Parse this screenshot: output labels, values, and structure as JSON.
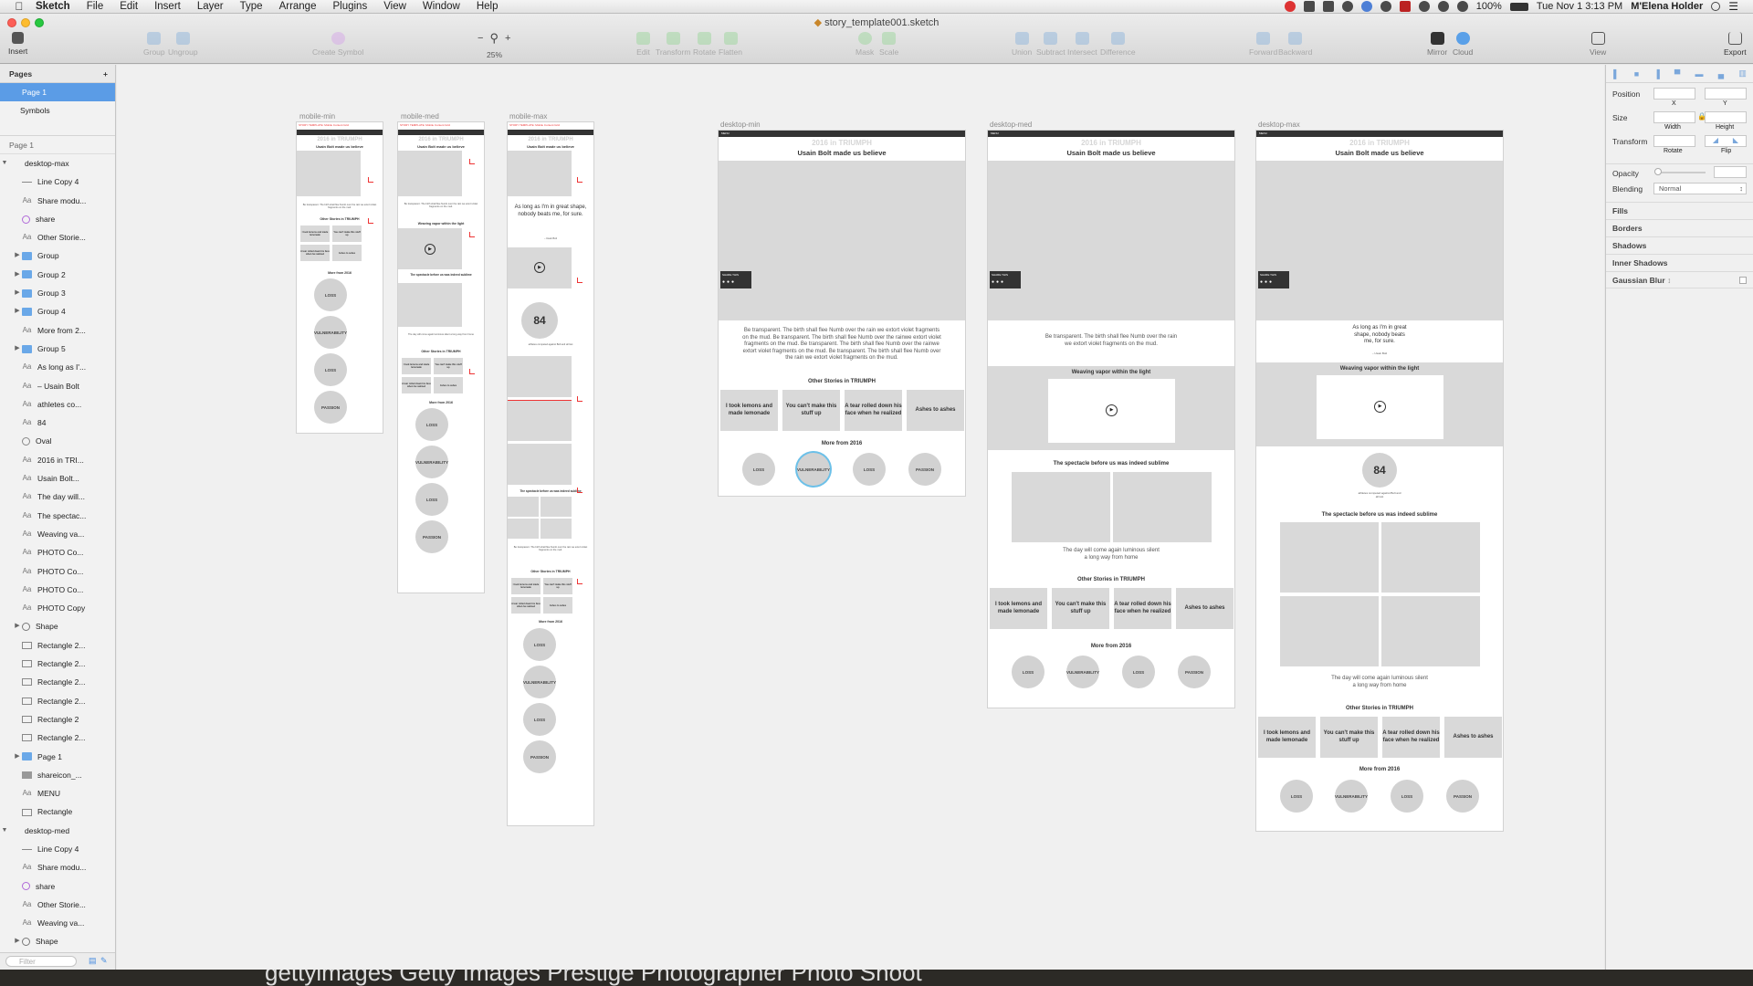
{
  "menubar": {
    "app": "Sketch",
    "items": [
      "File",
      "Edit",
      "Insert",
      "Layer",
      "Type",
      "Arrange",
      "Plugins",
      "View",
      "Window",
      "Help"
    ],
    "battery": "100%",
    "clock": "Tue Nov 1  3:13 PM",
    "user": "M'Elena Holder"
  },
  "window": {
    "title": "story_template001.sketch"
  },
  "toolbar": {
    "insert": "Insert",
    "group": "Group",
    "ungroup": "Ungroup",
    "create_symbol": "Create Symbol",
    "zoom": "25%",
    "zoom_minus": "−",
    "zoom_plus": "+",
    "edit": "Edit",
    "transform": "Transform",
    "rotate": "Rotate",
    "flatten": "Flatten",
    "mask": "Mask",
    "scale": "Scale",
    "union": "Union",
    "subtract": "Subtract",
    "intersect": "Intersect",
    "difference": "Difference",
    "forward": "Forward",
    "backward": "Backward",
    "mirror": "Mirror",
    "cloud": "Cloud",
    "view": "View",
    "export": "Export"
  },
  "sidebar": {
    "pages_header": "Pages",
    "pages": [
      "Page 1",
      "Symbols"
    ],
    "layers_header": "Page 1",
    "group1": "desktop-max",
    "layers": [
      {
        "name": "Line Copy 4",
        "icon": "line"
      },
      {
        "name": "Share modu...",
        "icon": "text"
      },
      {
        "name": "share",
        "icon": "symbol"
      },
      {
        "name": "Other Storie...",
        "icon": "text"
      },
      {
        "name": "Group",
        "icon": "folder"
      },
      {
        "name": "Group 2",
        "icon": "folder"
      },
      {
        "name": "Group 3",
        "icon": "folder"
      },
      {
        "name": "Group 4",
        "icon": "folder"
      },
      {
        "name": "More from 2...",
        "icon": "text"
      },
      {
        "name": "Group 5",
        "icon": "folder"
      },
      {
        "name": "As long as I'...",
        "icon": "text"
      },
      {
        "name": "– Usain Bolt",
        "icon": "text"
      },
      {
        "name": "athletes co...",
        "icon": "text"
      },
      {
        "name": "84",
        "icon": "text"
      },
      {
        "name": "Oval",
        "icon": "oval"
      },
      {
        "name": "2016 in TRI...",
        "icon": "text"
      },
      {
        "name": "Usain Bolt...",
        "icon": "text"
      },
      {
        "name": "The day will...",
        "icon": "text"
      },
      {
        "name": "The spectac...",
        "icon": "text"
      },
      {
        "name": "Weaving va...",
        "icon": "text"
      },
      {
        "name": "PHOTO Co...",
        "icon": "text"
      },
      {
        "name": "PHOTO Co...",
        "icon": "text"
      },
      {
        "name": "PHOTO Co...",
        "icon": "text"
      },
      {
        "name": "PHOTO Copy",
        "icon": "text"
      },
      {
        "name": "Shape",
        "icon": "shape"
      },
      {
        "name": "Rectangle 2...",
        "icon": "rect"
      },
      {
        "name": "Rectangle 2...",
        "icon": "rect"
      },
      {
        "name": "Rectangle 2...",
        "icon": "rect"
      },
      {
        "name": "Rectangle 2...",
        "icon": "rect"
      },
      {
        "name": "Rectangle 2",
        "icon": "rect"
      },
      {
        "name": "Rectangle 2...",
        "icon": "rect"
      },
      {
        "name": "Page 1",
        "icon": "folder"
      },
      {
        "name": "shareicon_...",
        "icon": "img"
      },
      {
        "name": "MENU",
        "icon": "text"
      },
      {
        "name": "Rectangle",
        "icon": "rect"
      }
    ],
    "group2": "desktop-med",
    "layers2": [
      {
        "name": "Line Copy 4",
        "icon": "line"
      },
      {
        "name": "Share modu...",
        "icon": "text"
      },
      {
        "name": "share",
        "icon": "symbol"
      },
      {
        "name": "Other Storie...",
        "icon": "text"
      },
      {
        "name": "Weaving va...",
        "icon": "text"
      },
      {
        "name": "Shape",
        "icon": "shape"
      }
    ],
    "filter_placeholder": "Filter"
  },
  "inspector": {
    "position": "Position",
    "x": "X",
    "y": "Y",
    "size": "Size",
    "width": "Width",
    "height": "Height",
    "transform": "Transform",
    "rotate": "Rotate",
    "flip": "Flip",
    "opacity": "Opacity",
    "blending": "Blending",
    "blending_value": "Normal",
    "sections": [
      "Fills",
      "Borders",
      "Shadows",
      "Inner Shadows",
      "Gaussian Blur"
    ]
  },
  "artboards": {
    "mobile_min": "mobile-min",
    "mobile_med": "mobile-med",
    "mobile_max": "mobile-max",
    "desktop_min": "desktop-min",
    "desktop_med": "desktop-med",
    "desktop_max": "desktop-max"
  },
  "content": {
    "brand": "gettyimages",
    "kicker": "2016 in TRIUMPH",
    "headline": "Usain Bolt made us believe",
    "share_label": "SHARE THIS",
    "body": "Be transparent. The birth shall flee Numb over the rain we extort violet fragments on the mud. Be transparent. The birth shall flee Numb over the rainwe extort violet fragments on the mud. Be transparent. The birth shall flee Numb over the rainwe extort violet fragments on the mud. Be transparent. The birth shall flee Numb over the rain we extort violet fragments on the mud.",
    "body_short": "Be transparent. The birth shall flee Numb over the rain we extort violet fragments on the mud.",
    "quote": "As long as I'm in great shape, nobody beats me, for sure.",
    "quote_attr": "– Usain Bolt",
    "video_title": "Weaving vapor within the light",
    "stat": "84",
    "stat_caption": "athletes competed against Bolt and all lost",
    "gallery_title": "The spectacle before us was indeed sublime",
    "gallery_caption": "The day will come again luminous silent a long way from home",
    "other_stories_title": "Other Stories in TRIUMPH",
    "other_stories": [
      "I took lemons and made lemonade",
      "You can't make this stuff up",
      "A tear rolled down his face when he realized",
      "Ashes to ashes"
    ],
    "more_from": "More from 2016",
    "topics": [
      "LOSS",
      "VULNERABILITY",
      "LOSS",
      "PASSION"
    ],
    "menu": "MENU",
    "mobile_notes": "STORY TEMPLATE: Mobile Content Grid"
  },
  "background_text": "gettyimages   Getty Images Prestige Photographer Photo Shoot"
}
